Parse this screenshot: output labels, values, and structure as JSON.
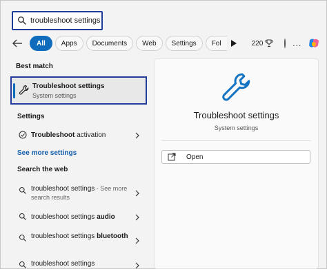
{
  "search": {
    "value": "troubleshoot settings",
    "icon": "search-icon"
  },
  "filters": {
    "chips": [
      "All",
      "Apps",
      "Documents",
      "Web",
      "Settings",
      "Fol"
    ],
    "active_index": 0,
    "points": "220",
    "more": "...",
    "accent": "#0f6cbd"
  },
  "left": {
    "best_match_heading": "Best match",
    "best_match": {
      "title": "Troubleshoot settings",
      "subtitle": "System settings"
    },
    "settings_heading": "Settings",
    "settings_items": [
      {
        "bold": "Troubleshoot",
        "rest": " activation"
      }
    ],
    "see_more": "See more settings",
    "web_heading": "Search the web",
    "web_items": [
      {
        "plain": "troubleshoot settings",
        "tail": " - See more search results"
      },
      {
        "plain": "troubleshoot settings ",
        "bold": "audio"
      },
      {
        "plain": "troubleshoot settings ",
        "bold": "bluetooth"
      },
      {
        "plain": "troubleshoot settings"
      }
    ]
  },
  "right": {
    "title": "Troubleshoot settings",
    "subtitle": "System settings",
    "open_label": "Open"
  },
  "colors": {
    "highlight_border": "#1f3c99",
    "link": "#0f5cab"
  }
}
